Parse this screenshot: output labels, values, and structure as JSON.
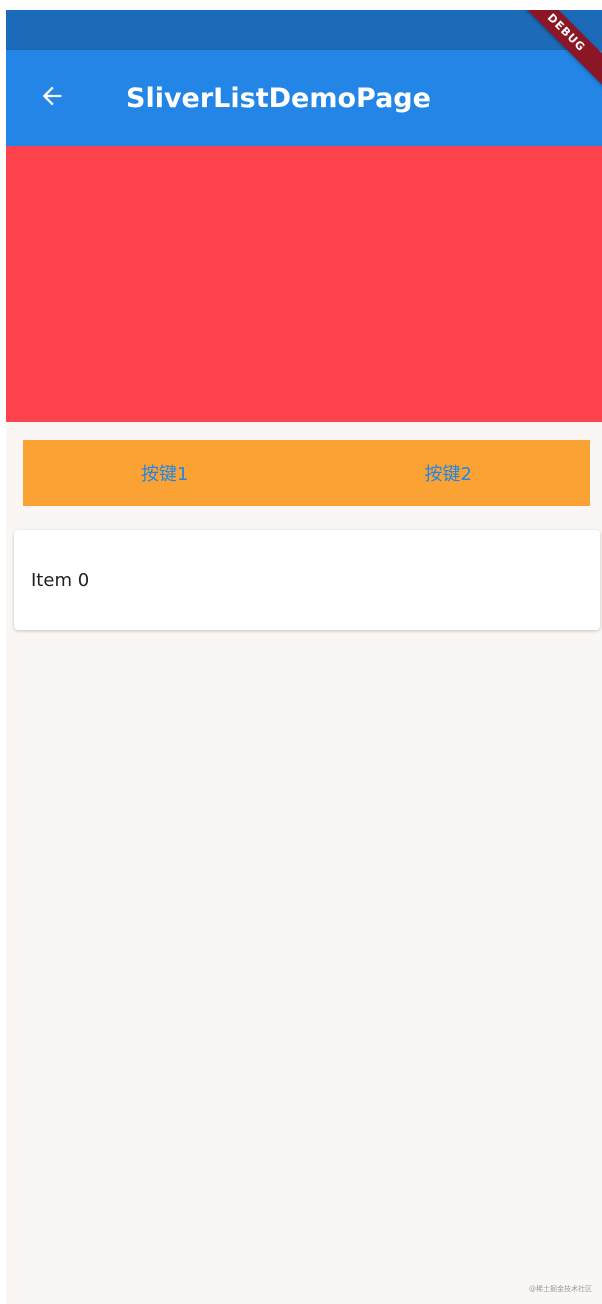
{
  "app_bar": {
    "title": "SliverListDemoPage",
    "back_icon": "arrow-back-icon",
    "debug_banner": "DEBUG"
  },
  "colors": {
    "status_bar": "#1c6bb8",
    "app_bar": "#2386e6",
    "header_block": "#fe434f",
    "button_row": "#faa233",
    "button_text": "#2386e6",
    "background": "#faf6f4"
  },
  "buttons": [
    {
      "label": "按键1"
    },
    {
      "label": "按键2"
    }
  ],
  "list": {
    "items": [
      {
        "label": "Item 0"
      }
    ]
  },
  "watermark": "@稀土掘金技术社区"
}
